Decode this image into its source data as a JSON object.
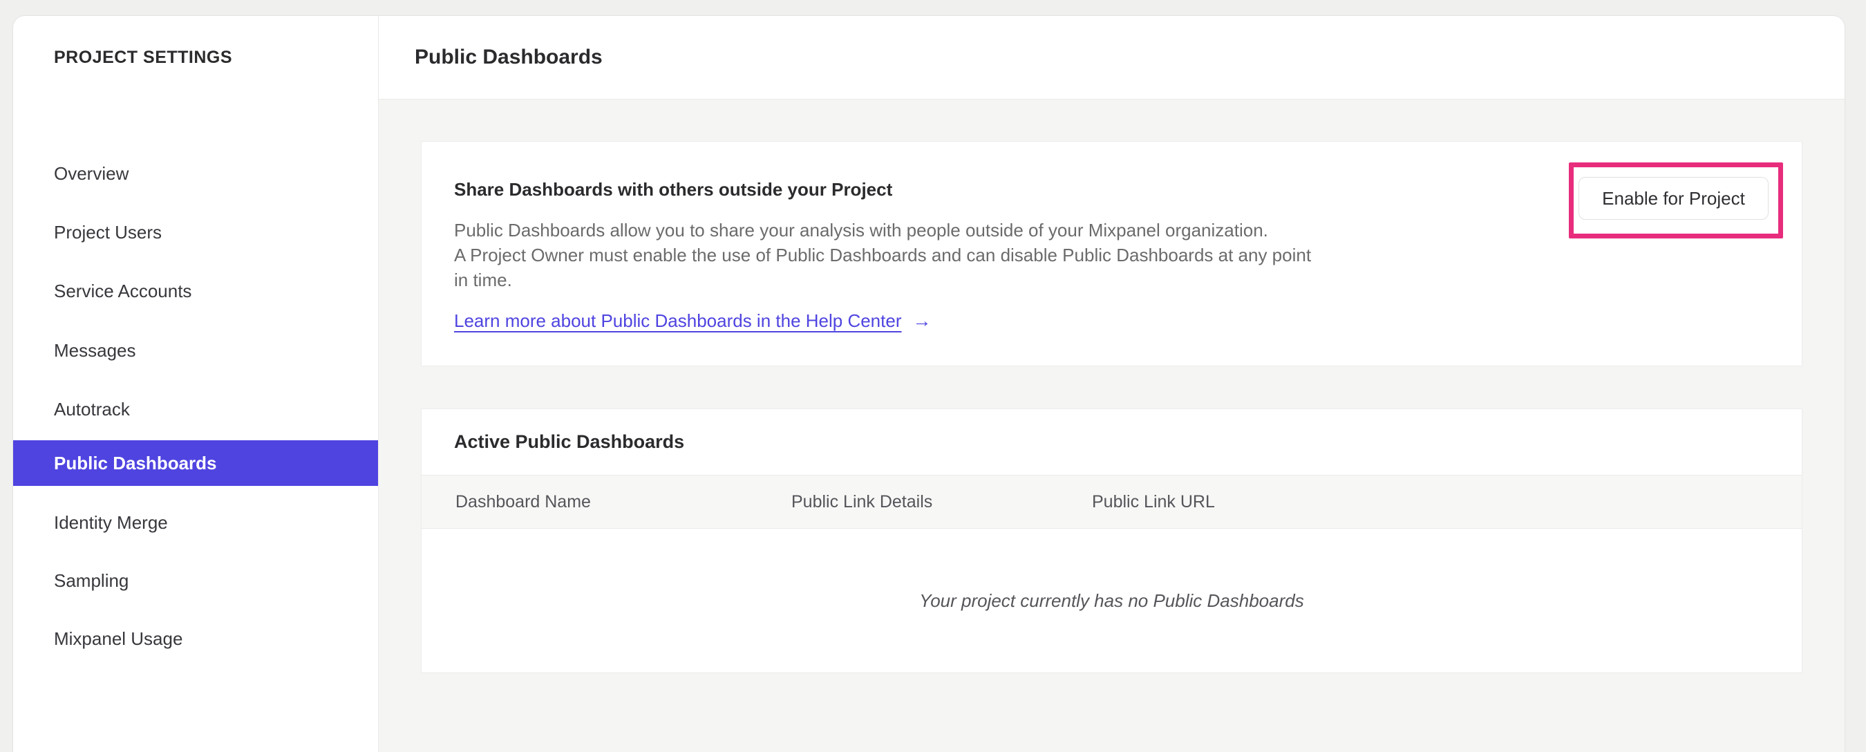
{
  "colors": {
    "accent_purple": "#4f44e0",
    "annotation_pink": "#e82d7d",
    "link": "#4f44e0",
    "page_background": "#f0f0ef",
    "content_background": "#f5f5f4"
  },
  "sidebar": {
    "title": "PROJECT SETTINGS",
    "items": [
      {
        "label": "Overview",
        "selected": false
      },
      {
        "label": "Project Users",
        "selected": false
      },
      {
        "label": "Service Accounts",
        "selected": false
      },
      {
        "label": "Messages",
        "selected": false
      },
      {
        "label": "Autotrack",
        "selected": false
      },
      {
        "label": "Public Dashboards",
        "selected": true
      },
      {
        "label": "Identity Merge",
        "selected": false
      },
      {
        "label": "Sampling",
        "selected": false
      },
      {
        "label": "Mixpanel Usage",
        "selected": false
      }
    ]
  },
  "header": {
    "title": "Public Dashboards"
  },
  "share_card": {
    "heading": "Share Dashboards with others outside your Project",
    "body_lines": [
      "Public Dashboards allow you to share your analysis with people outside of your Mixpanel organization.",
      "A Project Owner must enable the use of Public Dashboards and can disable Public Dashboards at any point",
      "in time."
    ],
    "link_label": "Learn more about Public Dashboards in the Help Center",
    "link_arrow": "→",
    "enable_button_label": "Enable for Project"
  },
  "active_card": {
    "title": "Active Public Dashboards",
    "columns": [
      "Dashboard Name",
      "Public Link Details",
      "Public Link URL"
    ],
    "empty_message": "Your project currently has no Public Dashboards"
  }
}
